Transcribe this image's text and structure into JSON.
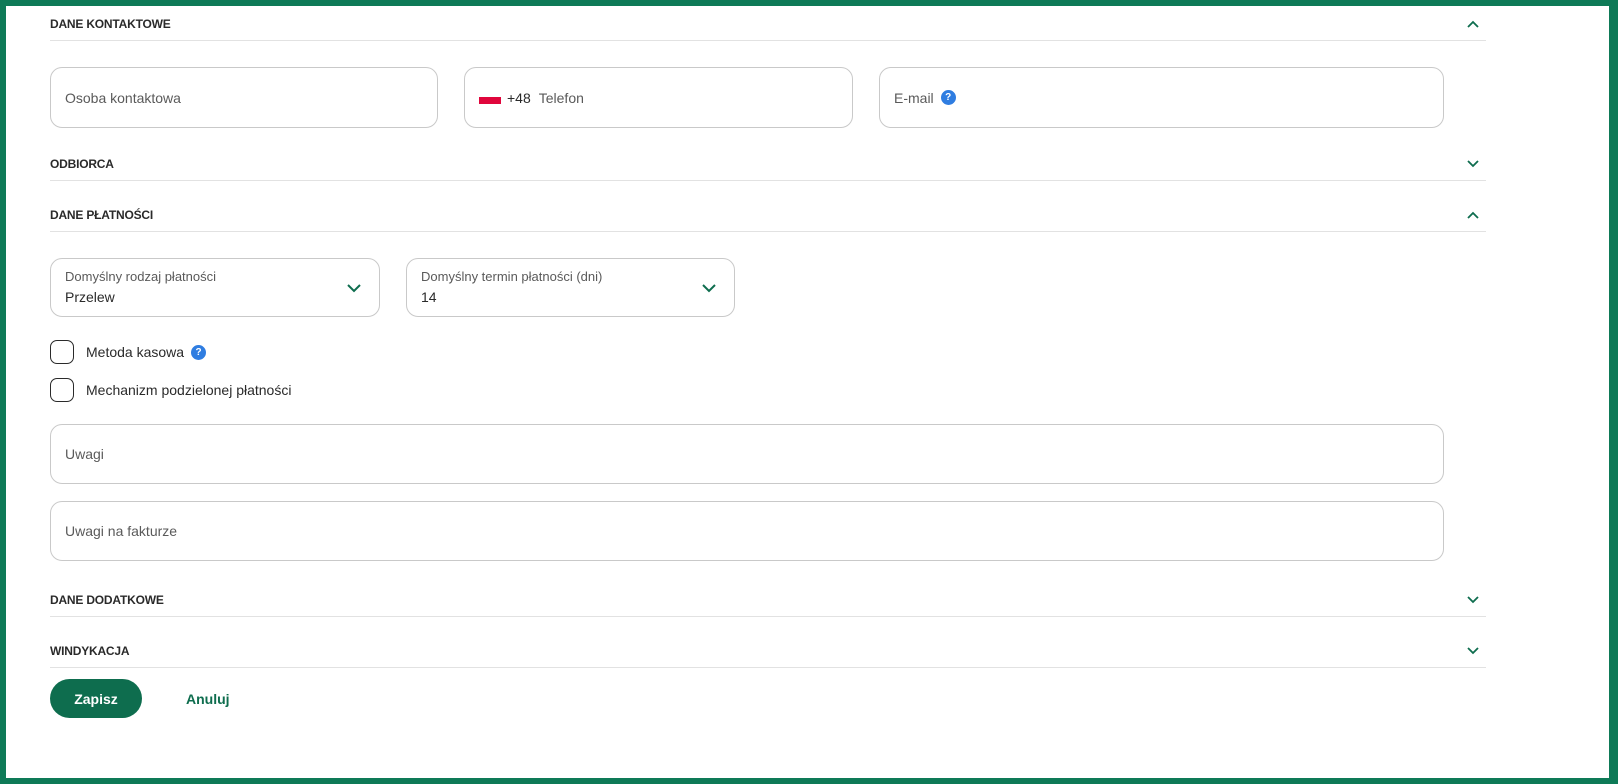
{
  "sections": {
    "contact": {
      "title": "DANE KONTAKTOWE",
      "expanded": true
    },
    "recipient": {
      "title": "ODBIORCA",
      "expanded": false
    },
    "payment": {
      "title": "DANE PŁATNOŚCI",
      "expanded": true
    },
    "additional": {
      "title": "DANE DODATKOWE",
      "expanded": false
    },
    "collection": {
      "title": "WINDYKACJA",
      "expanded": false
    }
  },
  "contact": {
    "person_placeholder": "Osoba kontaktowa",
    "phone_prefix": "+48",
    "phone_placeholder": "Telefon",
    "email_placeholder": "E-mail"
  },
  "payment": {
    "type_label": "Domyślny rodzaj płatności",
    "type_value": "Przelew",
    "term_label": "Domyślny termin płatności (dni)",
    "term_value": "14",
    "cash_method_label": "Metoda kasowa",
    "cash_method_checked": false,
    "split_payment_label": "Mechanizm podzielonej płatności",
    "split_payment_checked": false,
    "notes_placeholder": "Uwagi",
    "invoice_notes_placeholder": "Uwagi na fakturze"
  },
  "actions": {
    "save_label": "Zapisz",
    "cancel_label": "Anuluj"
  },
  "icons": {
    "help": "?",
    "chevron_up": "chevron-up-icon",
    "chevron_down": "chevron-down-icon",
    "flag": "poland-flag-icon"
  },
  "colors": {
    "accent": "#0e6d4e",
    "frame": "#0e7a57",
    "help": "#2f7de1",
    "flag_red": "#e0063c"
  }
}
